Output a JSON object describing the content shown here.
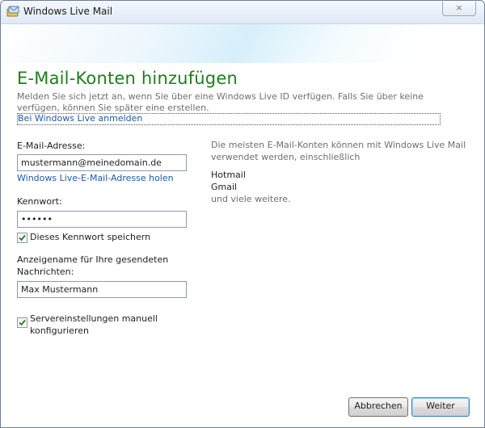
{
  "window": {
    "title": "Windows Live Mail",
    "close_label": "×"
  },
  "page": {
    "heading": "E-Mail-Konten hinzufügen",
    "intro": "Melden Sie sich jetzt an, wenn Sie über eine Windows Live ID verfügen. Falls Sie über keine verfügen, können Sie später eine erstellen.",
    "signin_link": "Bei Windows Live anmelden"
  },
  "form": {
    "email_label": "E-Mail-Adresse:",
    "email_value": "mustermann@meinedomain.de",
    "get_address_link": "Windows Live-E-Mail-Adresse holen",
    "password_label": "Kennwort:",
    "password_value": "••••••",
    "save_password_label": "Dieses Kennwort speichern",
    "save_password_checked": true,
    "display_name_label_1": "Anzeigename für Ihre gesendeten",
    "display_name_label_2": "Nachrichten:",
    "display_name_value": "Max Mustermann",
    "manual_config_label_1": "Servereinstellungen manuell",
    "manual_config_label_2": "konfigurieren",
    "manual_config_checked": true
  },
  "info": {
    "line1": "Die meisten E-Mail-Konten können mit Windows Live Mail",
    "line2": "verwendet werden, einschließlich",
    "providers": [
      "Hotmail",
      "Gmail"
    ],
    "more": "und viele weitere."
  },
  "buttons": {
    "cancel": "Abbrechen",
    "next": "Weiter"
  },
  "icons": {
    "app": "windows-live-mail-icon",
    "check": "checkmark-icon",
    "close": "close-icon"
  },
  "colors": {
    "heading": "#1e7d1e",
    "link": "#1d5aa8",
    "muted": "#6f6f6f"
  }
}
